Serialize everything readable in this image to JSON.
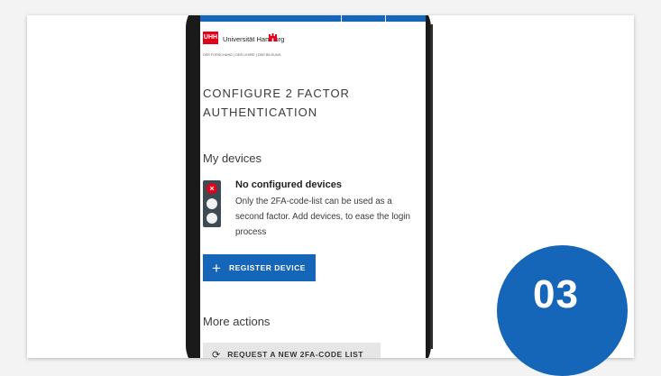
{
  "logo": {
    "mark": "UHH",
    "name": "Universität Hamburg",
    "tagline": "DER FORSCHUNG | DER LEHRE | DER BILDUNG"
  },
  "page": {
    "title": "CONFIGURE 2 FACTOR AUTHENTICATION"
  },
  "devices": {
    "heading": "My devices",
    "status_mark": "×",
    "status_title": "No configured devices",
    "status_desc": "Only the 2FA-code-list can be used as a second factor. Add devices, to ease the login process",
    "register_label": "REGISTER DEVICE"
  },
  "more_actions": {
    "heading": "More actions",
    "request_label": "REQUEST A NEW 2FA-CODE LIST"
  },
  "badge": {
    "label": "03"
  },
  "colors": {
    "brand_blue": "#1565b8",
    "uhh_red": "#e2001a",
    "indicator_dark": "#3d4a54"
  }
}
